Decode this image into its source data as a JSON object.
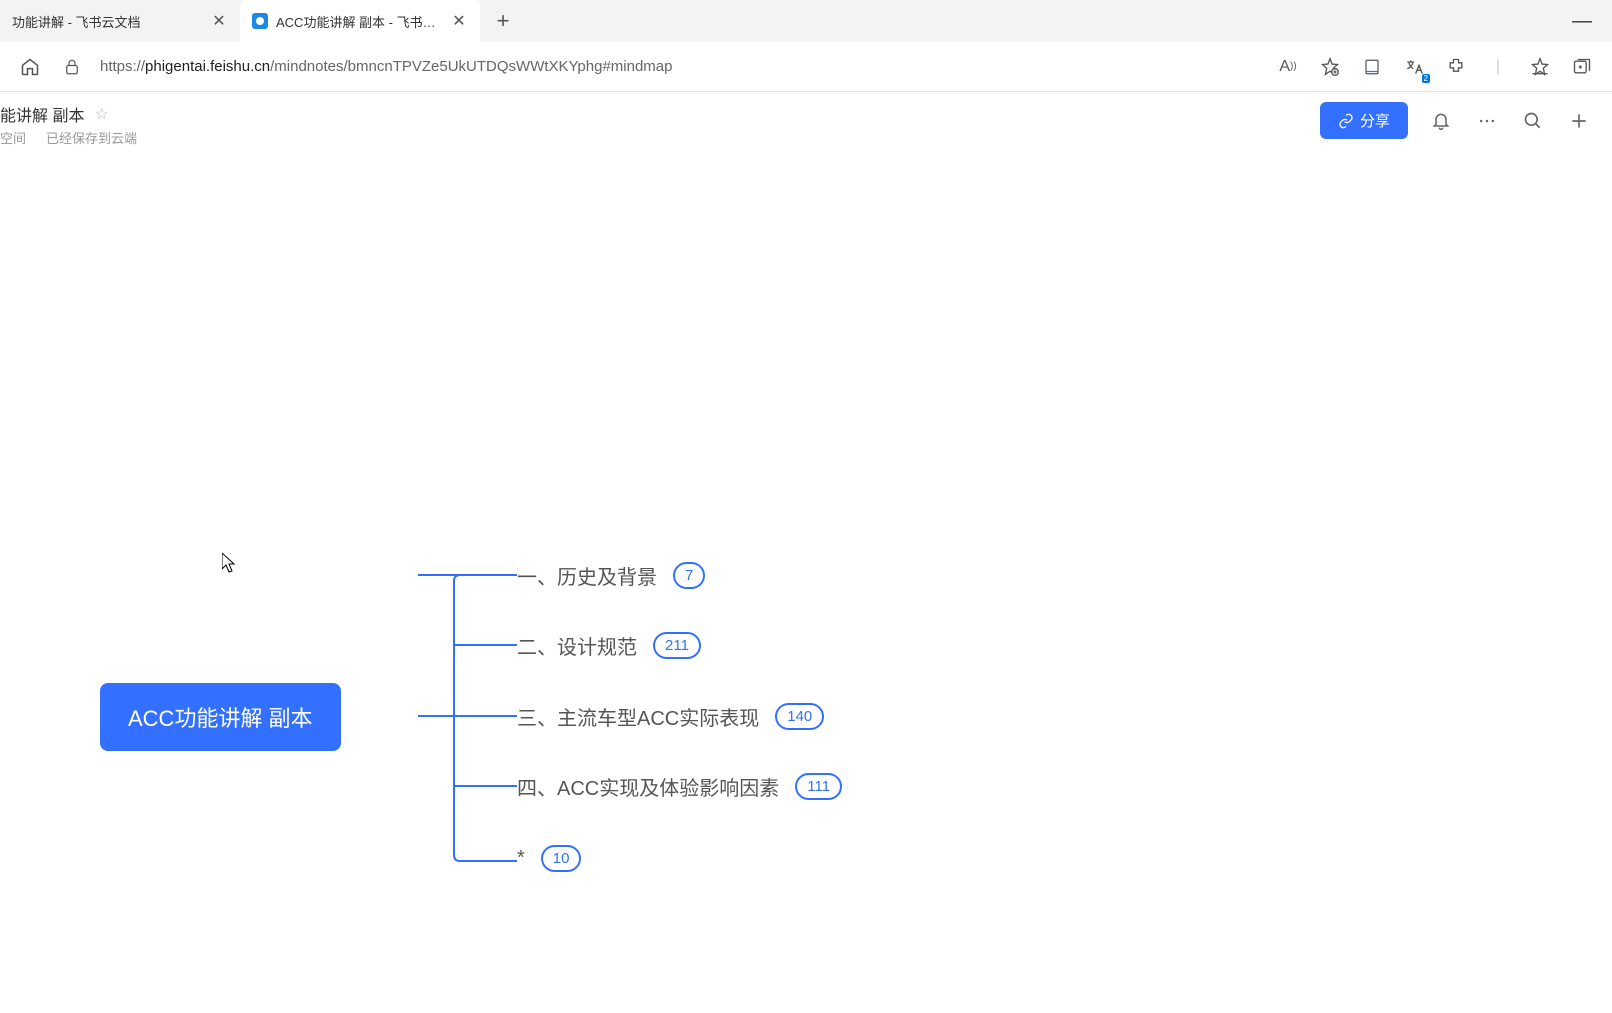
{
  "browser": {
    "tabs": [
      {
        "title": "功能讲解 - 飞书云文档",
        "active": false
      },
      {
        "title": "ACC功能讲解 副本 - 飞书云文档",
        "active": true
      }
    ],
    "url_prefix": "https://",
    "url_host": "phigentai.feishu.cn",
    "url_path": "/mindnotes/bmncnTPVZe5UkUTDQsWWtXKYphg#mindmap"
  },
  "doc": {
    "title_partial": "能讲解 副本",
    "meta_space": "空间",
    "meta_saved": "已经保存到云端",
    "share_label": "分享"
  },
  "mindmap": {
    "root": "ACC功能讲解 副本",
    "branches": [
      {
        "label": "一、历史及背景",
        "count": "7"
      },
      {
        "label": "二、设计规范",
        "count": "211"
      },
      {
        "label": "三、主流车型ACC实际表现",
        "count": "140"
      },
      {
        "label": "四、ACC实现及体验影响因素",
        "count": "111"
      },
      {
        "label": "*",
        "count": "10"
      }
    ]
  },
  "ext_badge": "2"
}
